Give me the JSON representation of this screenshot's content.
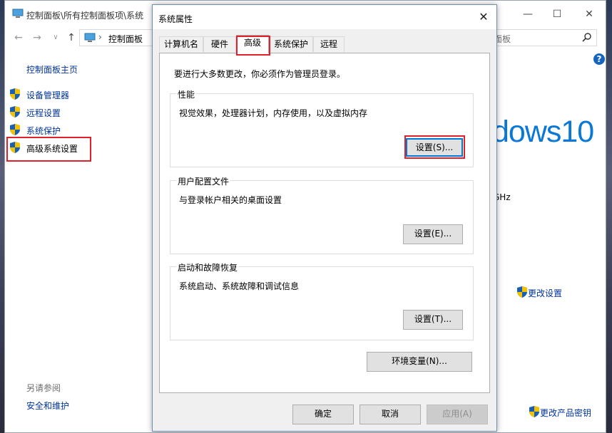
{
  "control_panel": {
    "title": "控制面板\\所有控制面板项\\系统",
    "window_controls": {
      "minimize": "—",
      "maximize": "☐",
      "close": "✕"
    },
    "address": {
      "crumb": "控制面板",
      "search_placeholder": "面板"
    },
    "sidebar": {
      "home": "控制面板主页",
      "items": [
        {
          "label": "设备管理器",
          "icon": "shield-icon"
        },
        {
          "label": "远程设置",
          "icon": "shield-icon"
        },
        {
          "label": "系统保护",
          "icon": "shield-icon"
        },
        {
          "label": "高级系统设置",
          "icon": "shield-icon"
        }
      ],
      "see_also": "另请参阅",
      "security_link": "安全和维护"
    },
    "main": {
      "windows_brand": "dows10",
      "cpu_fragment": "GHz",
      "change_settings": "更改设置",
      "change_product_key": "更改产品密钥",
      "help": "?"
    }
  },
  "dialog": {
    "title": "系统属性",
    "close": "✕",
    "tabs": [
      {
        "label": "计算机名"
      },
      {
        "label": "硬件"
      },
      {
        "label": "高级",
        "active": true
      },
      {
        "label": "系统保护"
      },
      {
        "label": "远程"
      }
    ],
    "admin_note": "要进行大多数更改，你必须作为管理员登录。",
    "performance": {
      "title": "性能",
      "desc": "视觉效果，处理器计划，内存使用，以及虚拟内存",
      "button": "设置(S)..."
    },
    "user_profiles": {
      "title": "用户配置文件",
      "desc": "与登录帐户相关的桌面设置",
      "button": "设置(E)..."
    },
    "startup_recovery": {
      "title": "启动和故障恢复",
      "desc": "系统启动、系统故障和调试信息",
      "button": "设置(T)..."
    },
    "env_button": "环境变量(N)...",
    "ok": "确定",
    "cancel": "取消",
    "apply": "应用(A)"
  },
  "colors": {
    "highlight": "#e0202a",
    "link": "#003399",
    "brand": "#0a78d7"
  }
}
